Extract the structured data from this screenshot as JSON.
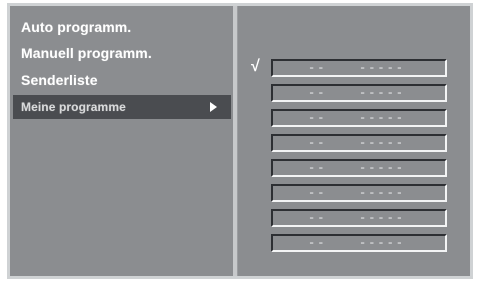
{
  "menu": {
    "items": [
      {
        "label": "Auto programm."
      },
      {
        "label": "Manuell programm."
      },
      {
        "label": "Senderliste"
      },
      {
        "label": "Meine programme",
        "selected": true
      }
    ]
  },
  "favorites": {
    "checkmark": "√",
    "slots": [
      {
        "number": "--",
        "name": "-----"
      },
      {
        "number": "--",
        "name": "-----"
      },
      {
        "number": "--",
        "name": "-----"
      },
      {
        "number": "--",
        "name": "-----"
      },
      {
        "number": "--",
        "name": "-----"
      },
      {
        "number": "--",
        "name": "-----"
      },
      {
        "number": "--",
        "name": "-----"
      },
      {
        "number": "--",
        "name": "-----"
      }
    ]
  },
  "colors": {
    "panel_background": "#8b8d90",
    "selected_item_background": "#4a4c50",
    "text": "#ffffff"
  },
  "icons": {
    "submenu_arrow": "triangle-right-icon"
  }
}
